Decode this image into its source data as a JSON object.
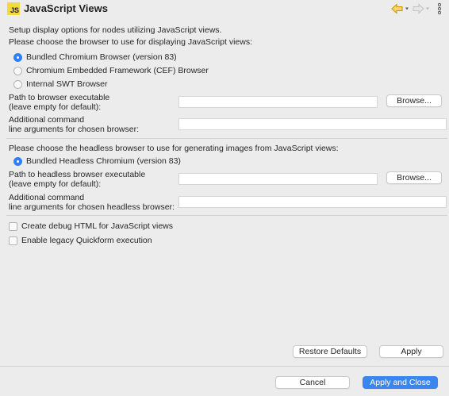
{
  "header": {
    "logo_text": "JS",
    "title": "JavaScript Views",
    "logo_color": "#f3d840"
  },
  "description": "Setup display options for nodes utilizing JavaScript views.",
  "browser_section": {
    "label": "Please choose the browser to use for displaying JavaScript views:",
    "options": [
      {
        "label": "Bundled Chromium Browser (version 83)",
        "selected": true
      },
      {
        "label": "Chromium Embedded Framework (CEF) Browser",
        "selected": false
      },
      {
        "label": "Internal SWT Browser",
        "selected": false
      }
    ],
    "path_label_line1": "Path to browser executable",
    "path_label_line2": "(leave empty for default):",
    "path_value": "",
    "browse_label": "Browse...",
    "args_label_line1": "Additional command",
    "args_label_line2": "line arguments for chosen browser:",
    "args_value": ""
  },
  "headless_section": {
    "label": "Please choose the headless browser to use for generating images from JavaScript views:",
    "options": [
      {
        "label": "Bundled Headless Chromium (version 83)",
        "selected": true
      }
    ],
    "path_label_line1": "Path to headless browser executable",
    "path_label_line2": "(leave empty for default):",
    "path_value": "",
    "browse_label": "Browse...",
    "args_label_line1": "Additional command",
    "args_label_line2": "line arguments for chosen headless browser:",
    "args_value": ""
  },
  "checkboxes": [
    {
      "label": "Create debug HTML for JavaScript views",
      "checked": false
    },
    {
      "label": "Enable legacy Quickform execution",
      "checked": false
    }
  ],
  "buttons": {
    "restore_defaults": "Restore Defaults",
    "apply": "Apply",
    "cancel": "Cancel",
    "apply_and_close": "Apply and Close"
  },
  "colors": {
    "accent": "#3a86f0",
    "background": "#ececec",
    "nav_arrow": "#d9a400"
  },
  "icons": {
    "back": "back-arrow-icon",
    "forward": "forward-arrow-icon",
    "menu": "more-vertical-icon"
  }
}
